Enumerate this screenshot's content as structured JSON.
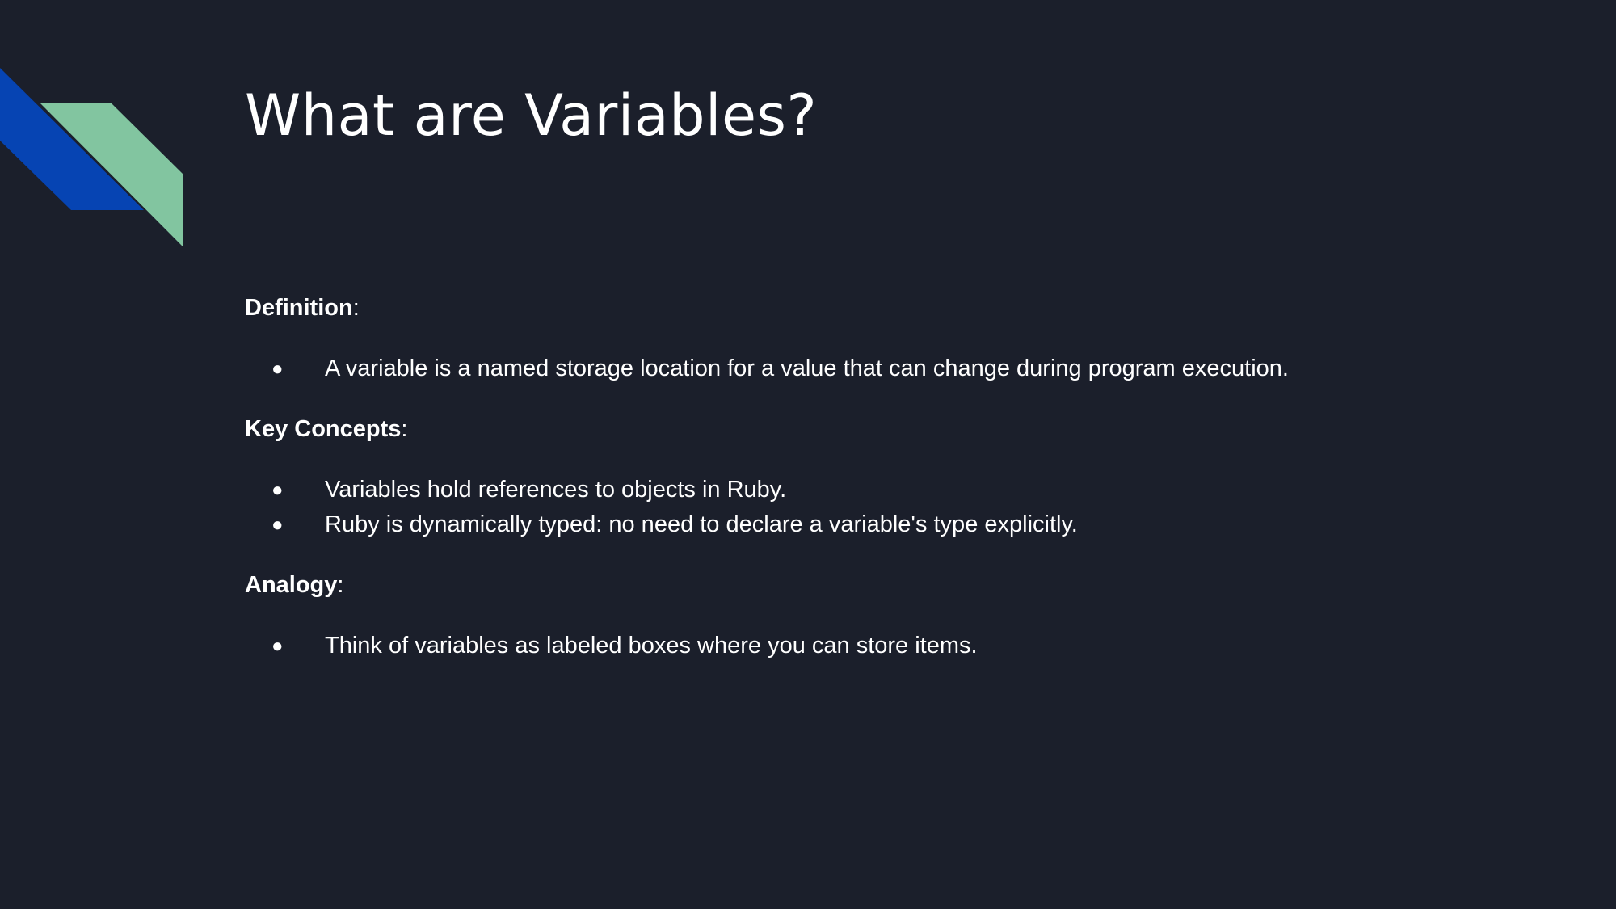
{
  "slide": {
    "title": "What are Variables?",
    "accent_colors": {
      "blue": "#0644b3",
      "green": "#82c5a0",
      "background": "#1b1f2b",
      "text": "#ffffff"
    },
    "sections": [
      {
        "heading": "Definition",
        "suffix": ":",
        "bullets": [
          "A variable is a named storage location for a value that can change during program execution."
        ]
      },
      {
        "heading": "Key Concepts",
        "suffix": ":",
        "bullets": [
          "Variables hold references to objects in Ruby.",
          "Ruby is dynamically typed: no need to declare a variable's type explicitly."
        ]
      },
      {
        "heading": "Analogy",
        "suffix": ":",
        "bullets": [
          "Think of variables as labeled boxes where you can store items."
        ]
      }
    ],
    "bullet_glyph": "●"
  }
}
